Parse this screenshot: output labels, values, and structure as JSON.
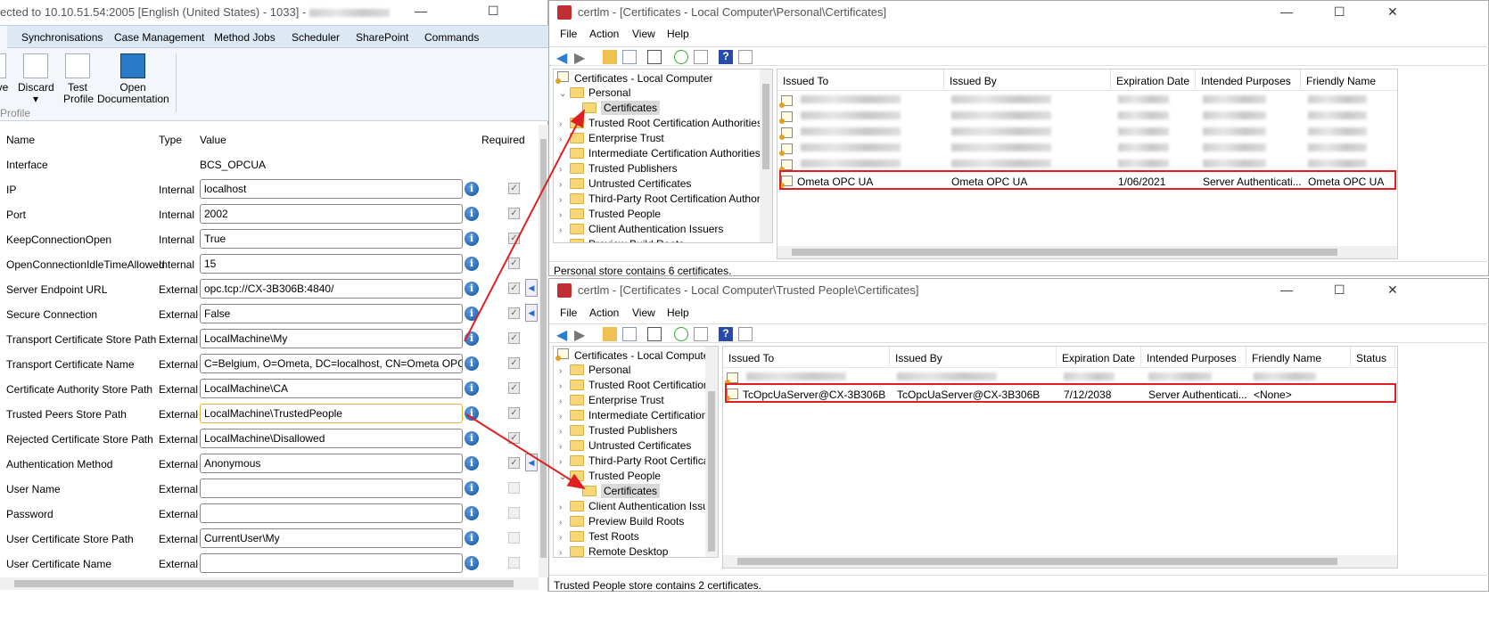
{
  "left_window": {
    "title": "ected to 10.10.51.54:2005 [English (United States) - 1033] -",
    "tabs": [
      "Synchronisations",
      "Case Management",
      "Method Jobs",
      "Scheduler",
      "SharePoint",
      "Commands"
    ],
    "ribbon": {
      "save": "ve",
      "discard": "Discard",
      "test": "Test Profile",
      "docs": "Open Documentation",
      "group": "Profile"
    },
    "headers": {
      "name": "Name",
      "type": "Type",
      "value": "Value",
      "required": "Required"
    },
    "interface": {
      "name": "Interface",
      "value": "BCS_OPCUA"
    },
    "rows": [
      {
        "name": "IP",
        "type": "Internal",
        "value": "localhost",
        "required": true
      },
      {
        "name": "Port",
        "type": "Internal",
        "value": "2002",
        "required": true
      },
      {
        "name": "KeepConnectionOpen",
        "type": "Internal",
        "value": "True",
        "required": true
      },
      {
        "name": "OpenConnectionIdleTimeAllowed",
        "type": "Internal",
        "value": "15",
        "required": true
      },
      {
        "name": "Server Endpoint URL",
        "type": "External",
        "value": "opc.tcp://CX-3B306B:4840/",
        "required": true
      },
      {
        "name": "Secure Connection",
        "type": "External",
        "value": "False",
        "required": true
      },
      {
        "name": "Transport Certificate Store Path",
        "type": "External",
        "value": "LocalMachine\\My",
        "required": true
      },
      {
        "name": "Transport Certificate Name",
        "type": "External",
        "value": "C=Belgium, O=Ometa, DC=localhost, CN=Ometa OPC UA",
        "required": true
      },
      {
        "name": "Certificate Authority Store Path",
        "type": "External",
        "value": "LocalMachine\\CA",
        "required": true
      },
      {
        "name": "Trusted Peers Store Path",
        "type": "External",
        "value": "LocalMachine\\TrustedPeople",
        "required": true
      },
      {
        "name": "Rejected Certificate Store Path",
        "type": "External",
        "value": "LocalMachine\\Disallowed",
        "required": true
      },
      {
        "name": "Authentication Method",
        "type": "External",
        "value": "Anonymous",
        "required": true
      },
      {
        "name": "User Name",
        "type": "External",
        "value": "",
        "required": false
      },
      {
        "name": "Password",
        "type": "External",
        "value": "",
        "required": false
      },
      {
        "name": "User Certificate Store Path",
        "type": "External",
        "value": "CurrentUser\\My",
        "required": false
      },
      {
        "name": "User Certificate Name",
        "type": "External",
        "value": "",
        "required": false
      }
    ]
  },
  "certlm_top": {
    "title": "certlm - [Certificates - Local Computer\\Personal\\Certificates]",
    "menu": [
      "File",
      "Action",
      "View",
      "Help"
    ],
    "tree_root": "Certificates - Local Computer",
    "tree": [
      "Personal",
      "Certificates",
      "Trusted Root Certification Authorities",
      "Enterprise Trust",
      "Intermediate Certification Authorities",
      "Trusted Publishers",
      "Untrusted Certificates",
      "Third-Party Root Certification Authorit",
      "Trusted People",
      "Client Authentication Issuers",
      "Preview Build Roots"
    ],
    "columns": [
      "Issued To",
      "Issued By",
      "Expiration Date",
      "Intended Purposes",
      "Friendly Name"
    ],
    "highlighted_row": [
      "Ometa OPC UA",
      "Ometa OPC UA",
      "1/06/2021",
      "Server Authenticati...",
      "Ometa OPC UA"
    ],
    "status": "Personal store contains 6 certificates."
  },
  "certlm_bottom": {
    "title": "certlm - [Certificates - Local Computer\\Trusted People\\Certificates]",
    "menu": [
      "File",
      "Action",
      "View",
      "Help"
    ],
    "tree_root": "Certificates - Local Computer",
    "tree": [
      "Personal",
      "Trusted Root Certification",
      "Enterprise Trust",
      "Intermediate Certification",
      "Trusted Publishers",
      "Untrusted Certificates",
      "Third-Party Root Certificat",
      "Trusted People",
      "Certificates",
      "Client Authentication Issu",
      "Preview Build Roots",
      "Test Roots",
      "Remote Desktop"
    ],
    "columns": [
      "Issued To",
      "Issued By",
      "Expiration Date",
      "Intended Purposes",
      "Friendly Name",
      "Status"
    ],
    "highlighted_row": [
      "TcOpcUaServer@CX-3B306B",
      "TcOpcUaServer@CX-3B306B",
      "7/12/2038",
      "Server Authenticati...",
      "<None>"
    ],
    "status": "Trusted People store contains 2 certificates."
  },
  "colors": {
    "highlight": "#e02020",
    "ribbon_bg": "#dde8f5"
  }
}
